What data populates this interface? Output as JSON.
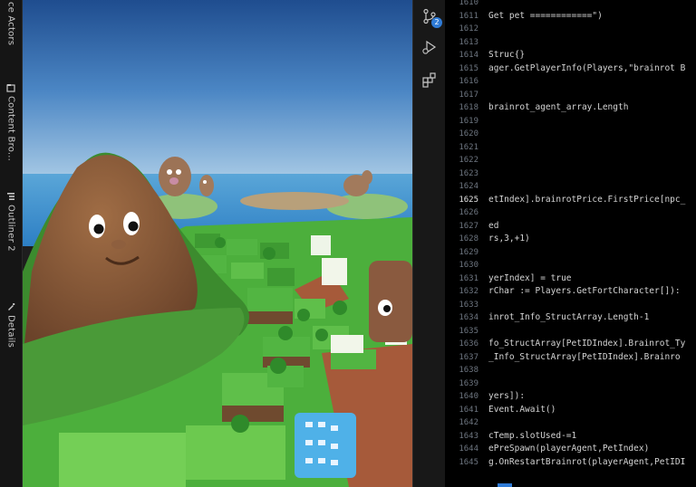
{
  "left_rail": {
    "tabs": [
      {
        "label": "Place Actors",
        "icon": "place-actors-icon",
        "label_visible": "ce Actors"
      },
      {
        "label": "Content Browser",
        "icon": "content-browser-icon",
        "label_visible": "Content Bro..."
      },
      {
        "label": "Outliner 2",
        "icon": "outliner-icon",
        "label_visible": "Outliner 2"
      },
      {
        "label": "Details",
        "icon": "details-icon",
        "label_visible": "Details"
      }
    ]
  },
  "activity_bar": {
    "source_control_badge": "2",
    "icons": [
      "source-control-icon",
      "run-debug-icon",
      "extensions-icon"
    ]
  },
  "editor": {
    "lines": [
      {
        "n": "1610",
        "code": ""
      },
      {
        "n": "1611",
        "code": "Get pet ============\")"
      },
      {
        "n": "1612",
        "code": ""
      },
      {
        "n": "1613",
        "code": ""
      },
      {
        "n": "1614",
        "code": "Struc{}"
      },
      {
        "n": "1615",
        "code": "ager.GetPlayerInfo(Players,\"brainrot B"
      },
      {
        "n": "1616",
        "code": ""
      },
      {
        "n": "1617",
        "code": ""
      },
      {
        "n": "1618",
        "code": "brainrot_agent_array.Length"
      },
      {
        "n": "1619",
        "code": ""
      },
      {
        "n": "1620",
        "code": ""
      },
      {
        "n": "1621",
        "code": ""
      },
      {
        "n": "1622",
        "code": ""
      },
      {
        "n": "1623",
        "code": ""
      },
      {
        "n": "1624",
        "code": ""
      },
      {
        "n": "1625",
        "code": "etIndex].brainrotPrice.FirstPrice[npc_"
      },
      {
        "n": "1626",
        "code": ""
      },
      {
        "n": "1627",
        "code": "ed"
      },
      {
        "n": "1628",
        "code": "rs,3,+1)"
      },
      {
        "n": "1629",
        "code": ""
      },
      {
        "n": "1630",
        "code": ""
      },
      {
        "n": "1631",
        "code": "yerIndex] = true"
      },
      {
        "n": "1632",
        "code": "rChar := Players.GetFortCharacter[]):"
      },
      {
        "n": "1633",
        "code": ""
      },
      {
        "n": "1634",
        "code": "inrot_Info_StructArray.Length-1"
      },
      {
        "n": "1635",
        "code": ""
      },
      {
        "n": "1636",
        "code": "fo_StructArray[PetIDIndex].Brainrot_Ty"
      },
      {
        "n": "1637",
        "code": "_Info_StructArray[PetIDIndex].Brainro"
      },
      {
        "n": "1638",
        "code": ""
      },
      {
        "n": "1639",
        "code": ""
      },
      {
        "n": "1640",
        "code": "yers]):"
      },
      {
        "n": "1641",
        "code": "Event.Await()"
      },
      {
        "n": "1642",
        "code": ""
      },
      {
        "n": "1643",
        "code": "cTemp.slotUsed-=1"
      },
      {
        "n": "1644",
        "code": "ePreSpawn(playerAgent,PetIndex)"
      },
      {
        "n": "1645",
        "code": "g.OnRestartBrainrot(playerAgent,PetIDI"
      }
    ],
    "active_line": "1625"
  },
  "colors": {
    "sky": "#3f78b8",
    "grass": "#4caf3c",
    "mountain": "#7a5134",
    "accent": "#2f7bd6"
  }
}
